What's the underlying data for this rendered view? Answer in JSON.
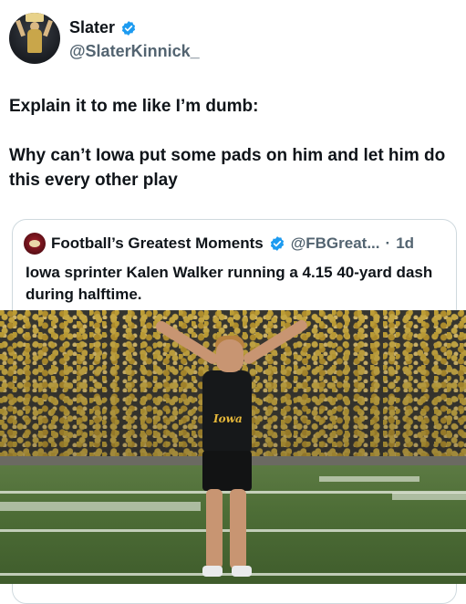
{
  "author": {
    "name": "Slater",
    "handle": "@SlaterKinnick_"
  },
  "tweet": {
    "line1": "Explain it to me like I’m dumb:",
    "line2": "Why can’t Iowa put some pads on him and let him do this every other play"
  },
  "quoted": {
    "name": "Football’s Greatest Moments",
    "handle": "@FBGreat...",
    "separator": "·",
    "time": "1d",
    "text": "Iowa sprinter Kalen Walker running a 4.15 40-yard dash during halftime.",
    "jersey_text": "Iowa"
  },
  "colors": {
    "verified": "#1d9bf0",
    "text": "#0f1419",
    "secondary": "#536471"
  },
  "icons": {
    "verified": "verified-badge-icon"
  }
}
